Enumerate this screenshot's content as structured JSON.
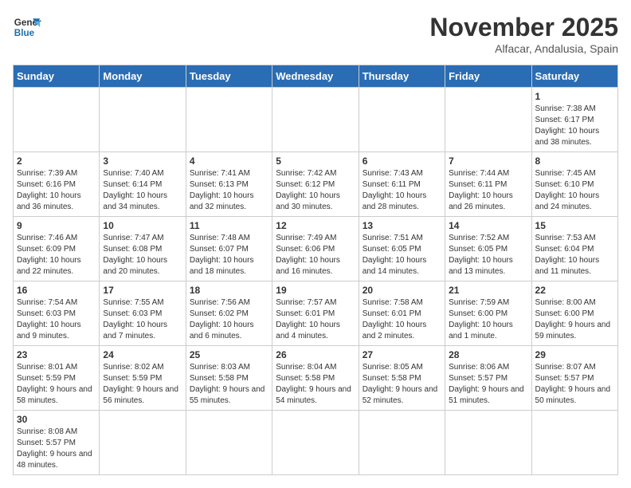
{
  "header": {
    "logo_general": "General",
    "logo_blue": "Blue",
    "month_title": "November 2025",
    "location": "Alfacar, Andalusia, Spain"
  },
  "weekdays": [
    "Sunday",
    "Monday",
    "Tuesday",
    "Wednesday",
    "Thursday",
    "Friday",
    "Saturday"
  ],
  "weeks": [
    [
      {
        "day": "",
        "info": ""
      },
      {
        "day": "",
        "info": ""
      },
      {
        "day": "",
        "info": ""
      },
      {
        "day": "",
        "info": ""
      },
      {
        "day": "",
        "info": ""
      },
      {
        "day": "",
        "info": ""
      },
      {
        "day": "1",
        "info": "Sunrise: 7:38 AM\nSunset: 6:17 PM\nDaylight: 10 hours and 38 minutes."
      }
    ],
    [
      {
        "day": "2",
        "info": "Sunrise: 7:39 AM\nSunset: 6:16 PM\nDaylight: 10 hours and 36 minutes."
      },
      {
        "day": "3",
        "info": "Sunrise: 7:40 AM\nSunset: 6:14 PM\nDaylight: 10 hours and 34 minutes."
      },
      {
        "day": "4",
        "info": "Sunrise: 7:41 AM\nSunset: 6:13 PM\nDaylight: 10 hours and 32 minutes."
      },
      {
        "day": "5",
        "info": "Sunrise: 7:42 AM\nSunset: 6:12 PM\nDaylight: 10 hours and 30 minutes."
      },
      {
        "day": "6",
        "info": "Sunrise: 7:43 AM\nSunset: 6:11 PM\nDaylight: 10 hours and 28 minutes."
      },
      {
        "day": "7",
        "info": "Sunrise: 7:44 AM\nSunset: 6:11 PM\nDaylight: 10 hours and 26 minutes."
      },
      {
        "day": "8",
        "info": "Sunrise: 7:45 AM\nSunset: 6:10 PM\nDaylight: 10 hours and 24 minutes."
      }
    ],
    [
      {
        "day": "9",
        "info": "Sunrise: 7:46 AM\nSunset: 6:09 PM\nDaylight: 10 hours and 22 minutes."
      },
      {
        "day": "10",
        "info": "Sunrise: 7:47 AM\nSunset: 6:08 PM\nDaylight: 10 hours and 20 minutes."
      },
      {
        "day": "11",
        "info": "Sunrise: 7:48 AM\nSunset: 6:07 PM\nDaylight: 10 hours and 18 minutes."
      },
      {
        "day": "12",
        "info": "Sunrise: 7:49 AM\nSunset: 6:06 PM\nDaylight: 10 hours and 16 minutes."
      },
      {
        "day": "13",
        "info": "Sunrise: 7:51 AM\nSunset: 6:05 PM\nDaylight: 10 hours and 14 minutes."
      },
      {
        "day": "14",
        "info": "Sunrise: 7:52 AM\nSunset: 6:05 PM\nDaylight: 10 hours and 13 minutes."
      },
      {
        "day": "15",
        "info": "Sunrise: 7:53 AM\nSunset: 6:04 PM\nDaylight: 10 hours and 11 minutes."
      }
    ],
    [
      {
        "day": "16",
        "info": "Sunrise: 7:54 AM\nSunset: 6:03 PM\nDaylight: 10 hours and 9 minutes."
      },
      {
        "day": "17",
        "info": "Sunrise: 7:55 AM\nSunset: 6:03 PM\nDaylight: 10 hours and 7 minutes."
      },
      {
        "day": "18",
        "info": "Sunrise: 7:56 AM\nSunset: 6:02 PM\nDaylight: 10 hours and 6 minutes."
      },
      {
        "day": "19",
        "info": "Sunrise: 7:57 AM\nSunset: 6:01 PM\nDaylight: 10 hours and 4 minutes."
      },
      {
        "day": "20",
        "info": "Sunrise: 7:58 AM\nSunset: 6:01 PM\nDaylight: 10 hours and 2 minutes."
      },
      {
        "day": "21",
        "info": "Sunrise: 7:59 AM\nSunset: 6:00 PM\nDaylight: 10 hours and 1 minute."
      },
      {
        "day": "22",
        "info": "Sunrise: 8:00 AM\nSunset: 6:00 PM\nDaylight: 9 hours and 59 minutes."
      }
    ],
    [
      {
        "day": "23",
        "info": "Sunrise: 8:01 AM\nSunset: 5:59 PM\nDaylight: 9 hours and 58 minutes."
      },
      {
        "day": "24",
        "info": "Sunrise: 8:02 AM\nSunset: 5:59 PM\nDaylight: 9 hours and 56 minutes."
      },
      {
        "day": "25",
        "info": "Sunrise: 8:03 AM\nSunset: 5:58 PM\nDaylight: 9 hours and 55 minutes."
      },
      {
        "day": "26",
        "info": "Sunrise: 8:04 AM\nSunset: 5:58 PM\nDaylight: 9 hours and 54 minutes."
      },
      {
        "day": "27",
        "info": "Sunrise: 8:05 AM\nSunset: 5:58 PM\nDaylight: 9 hours and 52 minutes."
      },
      {
        "day": "28",
        "info": "Sunrise: 8:06 AM\nSunset: 5:57 PM\nDaylight: 9 hours and 51 minutes."
      },
      {
        "day": "29",
        "info": "Sunrise: 8:07 AM\nSunset: 5:57 PM\nDaylight: 9 hours and 50 minutes."
      }
    ],
    [
      {
        "day": "30",
        "info": "Sunrise: 8:08 AM\nSunset: 5:57 PM\nDaylight: 9 hours and 48 minutes."
      },
      {
        "day": "",
        "info": ""
      },
      {
        "day": "",
        "info": ""
      },
      {
        "day": "",
        "info": ""
      },
      {
        "day": "",
        "info": ""
      },
      {
        "day": "",
        "info": ""
      },
      {
        "day": "",
        "info": ""
      }
    ]
  ]
}
